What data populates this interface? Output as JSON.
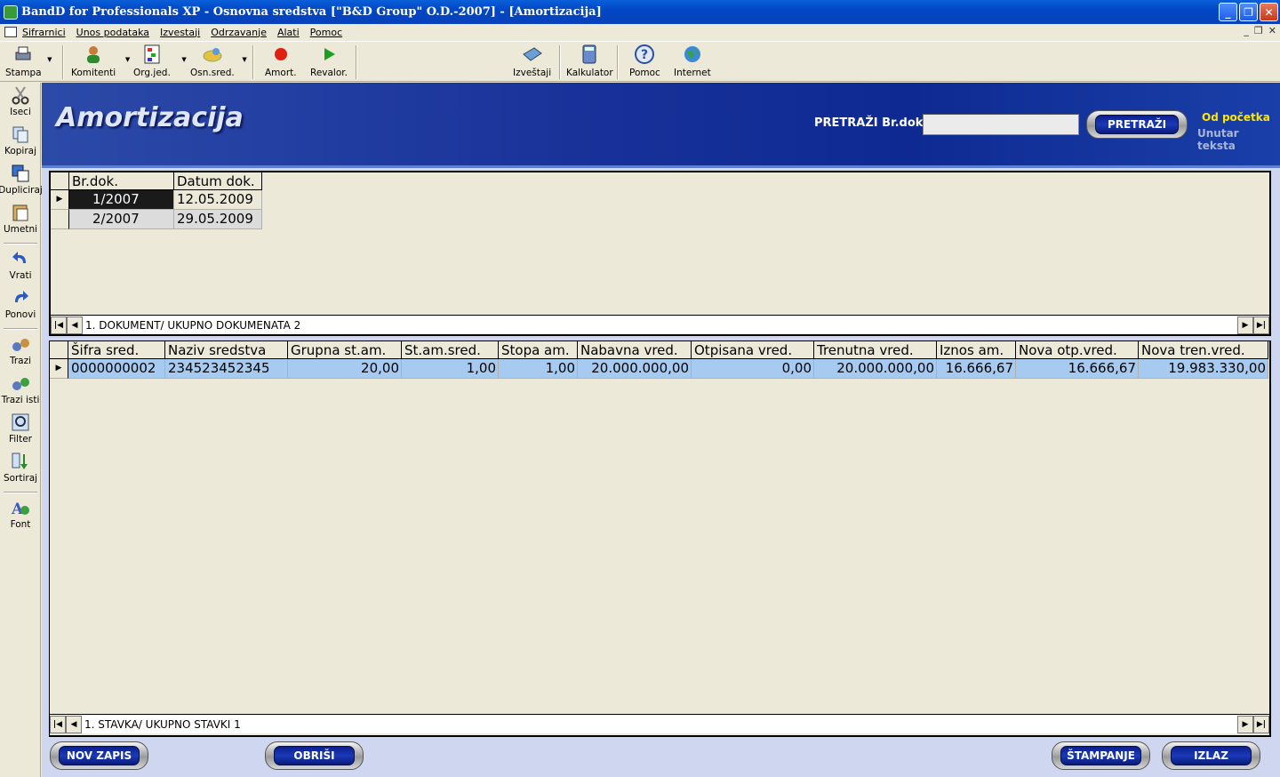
{
  "window": {
    "title": "BandD for Professionals XP - Osnovna sredstva [\"B&D Group\" O.D.-2007] - [Amortizacija]"
  },
  "menu": [
    "Sifrarnici",
    "Unos podataka",
    "Izvestaji",
    "Odrzavanje",
    "Alati",
    "Pomoc"
  ],
  "toolbar": {
    "stampa": "Stampa",
    "komitenti": "Komitenti",
    "orgjed": "Org.jed.",
    "osnsred": "Osn.sred.",
    "amort": "Amort.",
    "revalor": "Revalor.",
    "izvestaji": "Izveštaji",
    "kalkulator": "Kalkulator",
    "pomoc": "Pomoc",
    "internet": "Internet"
  },
  "sidebar": {
    "iseci": "Iseci",
    "kopiraj": "Kopiraj",
    "dupliciraj": "Dupliciraj",
    "umetni": "Umetni",
    "vrati": "Vrati",
    "ponovi": "Ponovi",
    "trazi": "Trazi",
    "trazi_isti": "Trazi isti",
    "filter": "Filter",
    "sortiraj": "Sortiraj",
    "font": "Font"
  },
  "page": {
    "title": "Amortizacija"
  },
  "search": {
    "label": "PRETRAŽI Br.dok.",
    "value": "",
    "button": "PRETRAŽI",
    "opt_from_start": "Od početka",
    "opt_in_text": "Unutar teksta"
  },
  "documents": {
    "columns": [
      "Br.dok.",
      "Datum dok."
    ],
    "rows": [
      [
        "1/2007",
        "12.05.2009"
      ],
      [
        "2/2007",
        "29.05.2009"
      ]
    ],
    "status": "1. DOKUMENT/  UKUPNO DOKUMENATA 2"
  },
  "items": {
    "columns": [
      "Šifra sred.",
      "Naziv sredstva",
      "Grupna st.am.",
      "St.am.sred.",
      "Stopa am.",
      "Nabavna vred.",
      "Otpisana vred.",
      "Trenutna vred.",
      "Iznos am.",
      "Nova otp.vred.",
      "Nova tren.vred."
    ],
    "rows": [
      [
        "0000000002",
        "234523452345",
        "20,00",
        "1,00",
        "1,00",
        "20.000.000,00",
        "0,00",
        "20.000.000,00",
        "16.666,67",
        "16.666,67",
        "19.983.330,00"
      ]
    ],
    "status": "1. STAVKA/  UKUPNO STAVKI 1"
  },
  "buttons": {
    "new": "NOV ZAPIS",
    "delete": "OBRIŠI",
    "print": "ŠTAMPANJE",
    "exit": "IZLAZ"
  },
  "colors": {
    "banner": "#18319a",
    "selected_row": "#a6caf0",
    "search_opt_active": "#ffe600"
  }
}
